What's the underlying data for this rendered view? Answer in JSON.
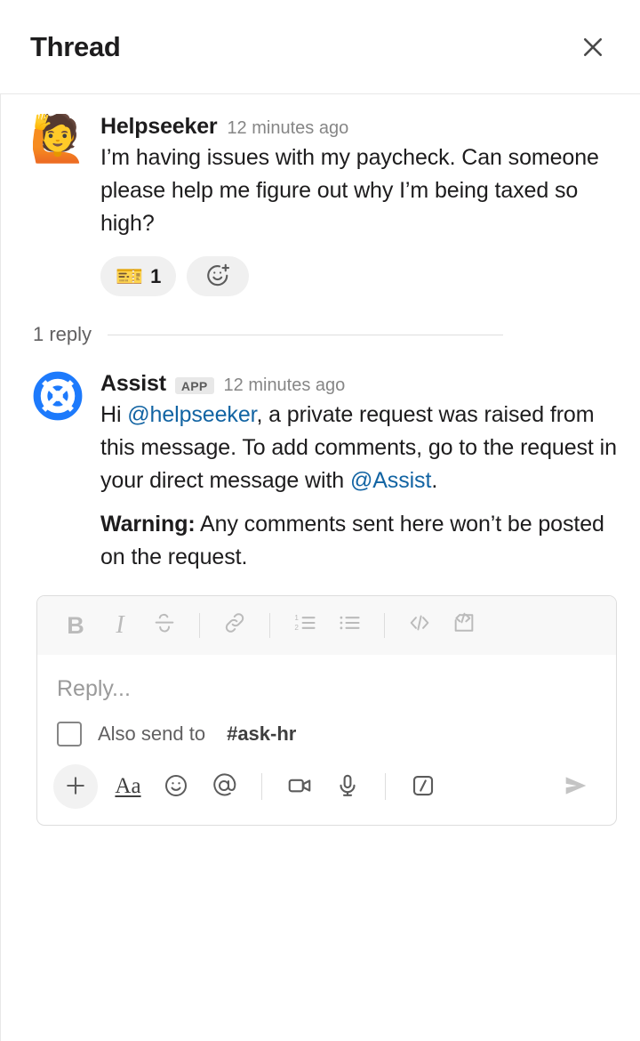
{
  "header": {
    "title": "Thread",
    "close_label": "Close",
    "close_icon": "close-icon"
  },
  "root_message": {
    "avatar_emoji": "🙋",
    "avatar_name": "person-raising-hand-avatar",
    "author": "Helpseeker",
    "timestamp": "12 minutes ago",
    "text": "I’m having issues with my paycheck. Can someone please help me figure out why I’m being taxed so high?",
    "reactions": [
      {
        "emoji": "🎫",
        "emoji_name": "ticket-emoji",
        "count": "1"
      }
    ],
    "add_reaction_icon": "add-reaction-icon"
  },
  "reply_divider": {
    "label": "1 reply"
  },
  "reply_message": {
    "avatar_name": "lifebuoy-app-avatar",
    "avatar_color": "#1d7afc",
    "author": "Assist",
    "badge": "APP",
    "timestamp": "12 minutes ago",
    "paragraph1": {
      "prefix": "Hi ",
      "mention1": "@helpseeker",
      "middle": ",  a private request was raised from this message. To add comments, go to the request in your direct message with ",
      "mention2": "@Assist",
      "suffix": "."
    },
    "paragraph2": {
      "bold_prefix": "Warning:",
      "rest": " Any comments sent here won’t be posted on the request."
    },
    "mention_color": "#1264a3"
  },
  "composer": {
    "format_toolbar": [
      {
        "name": "bold-button",
        "label": "B"
      },
      {
        "name": "italic-button",
        "label": "I"
      },
      {
        "name": "strikethrough-button",
        "label": "S"
      },
      {
        "name": "link-button",
        "label": ""
      },
      {
        "name": "ordered-list-button",
        "label": ""
      },
      {
        "name": "bulleted-list-button",
        "label": ""
      },
      {
        "name": "code-button",
        "label": ""
      },
      {
        "name": "code-block-button",
        "label": ""
      }
    ],
    "reply_placeholder": "Reply...",
    "also_send_label": "Also send to",
    "channel": "#ask-hr",
    "checkbox_checked": false,
    "actions": [
      {
        "name": "add-attachment-button"
      },
      {
        "name": "formatting-button",
        "label": "Aa"
      },
      {
        "name": "emoji-button"
      },
      {
        "name": "mention-button"
      },
      {
        "name": "video-clip-button"
      },
      {
        "name": "audio-clip-button"
      },
      {
        "name": "slash-command-button"
      }
    ],
    "send_label": "Send",
    "send_enabled": false
  }
}
